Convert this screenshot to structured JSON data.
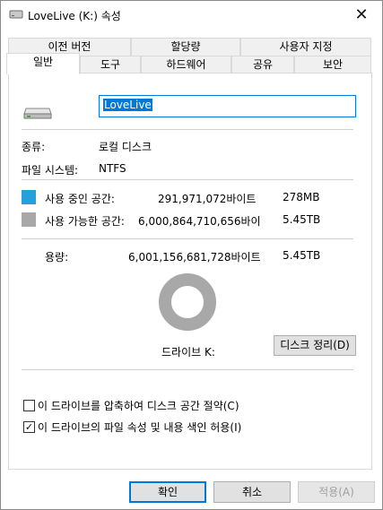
{
  "window": {
    "title": "LoveLive (K:) 속성",
    "close_glyph": "✕"
  },
  "tabs_row1": [
    "이전 버전",
    "할당량",
    "사용자 지정"
  ],
  "tabs_row2": [
    "일반",
    "도구",
    "하드웨어",
    "공유",
    "보안"
  ],
  "general": {
    "volume_name": "LoveLive",
    "type_label": "종류:",
    "type_value": "로컬 디스크",
    "fs_label": "파일 시스템:",
    "fs_value": "NTFS",
    "used": {
      "label": "사용 중인 공간:",
      "bytes": "291,971,072바이트",
      "size": "278MB",
      "color": "#26a0da"
    },
    "free": {
      "label": "사용 가능한 공간:",
      "bytes": "6,000,864,710,656바이",
      "size": "5.45TB",
      "color": "#a8a8a8"
    },
    "capacity": {
      "label": "용량:",
      "bytes": "6,001,156,681,728바이트",
      "size": "5.45TB"
    },
    "used_fraction": 4.87e-05,
    "drive_label": "드라이브 K:",
    "cleanup_button": "디스크 정리(D)",
    "compress_label": "이 드라이브를 압축하여 디스크 공간 절약(C)",
    "compress_checked": false,
    "index_label": "이 드라이브의 파일 속성 및 내용 색인 허용(I)",
    "index_checked": true
  },
  "buttons": {
    "ok": "확인",
    "cancel": "취소",
    "apply": "적용(A)"
  }
}
